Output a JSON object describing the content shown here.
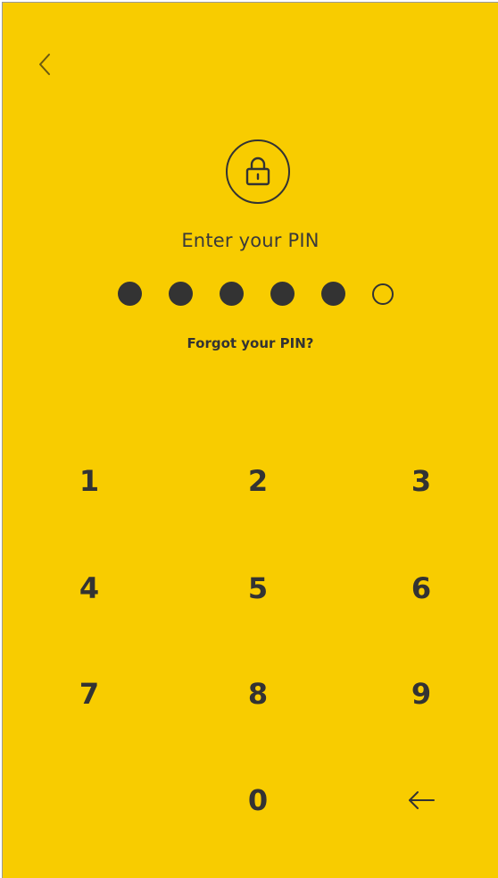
{
  "header": {
    "back_icon": "chevron-left-icon"
  },
  "lock": {
    "icon": "lock-icon"
  },
  "pin": {
    "prompt": "Enter your PIN",
    "length": 6,
    "filled": 5
  },
  "forgot_label": "Forgot your PIN?",
  "keypad": {
    "keys": [
      "1",
      "2",
      "3",
      "4",
      "5",
      "6",
      "7",
      "8",
      "9",
      "0"
    ],
    "backspace_icon": "arrow-left-icon"
  },
  "colors": {
    "background": "#F8CC00",
    "foreground": "#333333"
  }
}
